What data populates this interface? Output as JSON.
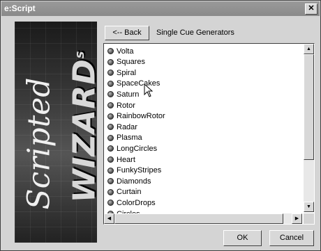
{
  "window": {
    "title": "e:Script",
    "close_glyph": "✕"
  },
  "banner": {
    "script_text": "Scripted",
    "wizard_text": "WIZARD",
    "superscript": "s"
  },
  "toolbar": {
    "back_label": "<-- Back",
    "section_title": "Single Cue Generators"
  },
  "generators": {
    "items": [
      "Volta",
      "Squares",
      "Spiral",
      "SpaceCakes",
      "Saturn",
      "Rotor",
      "RainbowRotor",
      "Radar",
      "Plasma",
      "LongCircles",
      "Heart",
      "FunkyStripes",
      "Diamonds",
      "Curtain",
      "ColorDrops",
      "Circles"
    ]
  },
  "scrollbar": {
    "up_glyph": "▲",
    "down_glyph": "▼",
    "left_glyph": "◀",
    "right_glyph": "▶"
  },
  "footer": {
    "ok_label": "OK",
    "cancel_label": "Cancel"
  }
}
